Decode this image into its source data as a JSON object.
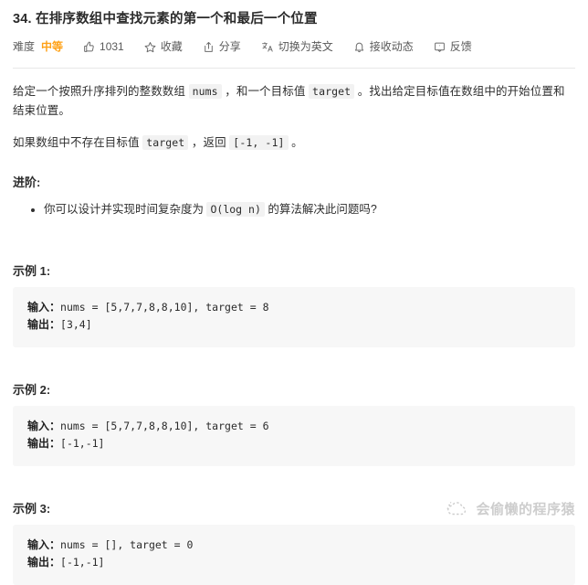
{
  "problem": {
    "number": "34.",
    "title": "在排序数组中查找元素的第一个和最后一个位置"
  },
  "toolbar": {
    "difficulty_label": "难度",
    "difficulty_value": "中等",
    "difficulty_color": "#FFA116",
    "like_count": "1031",
    "like_icon": "thumbs-up-icon",
    "favorite_label": "收藏",
    "favorite_icon": "star-icon",
    "share_label": "分享",
    "share_icon": "share-icon",
    "translate_label": "切换为英文",
    "translate_icon": "translate-icon",
    "subscribe_label": "接收动态",
    "subscribe_icon": "bell-icon",
    "feedback_label": "反馈",
    "feedback_icon": "comment-icon"
  },
  "description": {
    "p1_part1": "给定一个按照升序排列的整数数组 ",
    "p1_code1": "nums",
    "p1_part2": " ，和一个目标值 ",
    "p1_code2": "target",
    "p1_part3": " 。找出给定目标值在数组中的开始位置和结束位置。",
    "p2_part1": "如果数组中不存在目标值 ",
    "p2_code1": "target",
    "p2_part2": " ，返回 ",
    "p2_code2": "[-1, -1]",
    "p2_part3": " 。"
  },
  "advanced": {
    "heading": "进阶:",
    "item1_part1": "你可以设计并实现时间复杂度为 ",
    "item1_code": "O(log n)",
    "item1_part2": " 的算法解决此问题吗?"
  },
  "examples": [
    {
      "heading": "示例 1:",
      "input_label": "输入：",
      "input_value": "nums = [5,7,7,8,8,10], target = 8",
      "output_label": "输出：",
      "output_value": "[3,4]"
    },
    {
      "heading": "示例 2:",
      "input_label": "输入：",
      "input_value": "nums = [5,7,7,8,8,10], target = 6",
      "output_label": "输出：",
      "output_value": "[-1,-1]"
    },
    {
      "heading": "示例 3:",
      "input_label": "输入：",
      "input_value": "nums = [], target = 0",
      "output_label": "输出：",
      "output_value": "[-1,-1]"
    }
  ],
  "watermark": {
    "text": "会偷懒的程序猿",
    "logo_icon": "cloud-dots-logo-icon"
  }
}
